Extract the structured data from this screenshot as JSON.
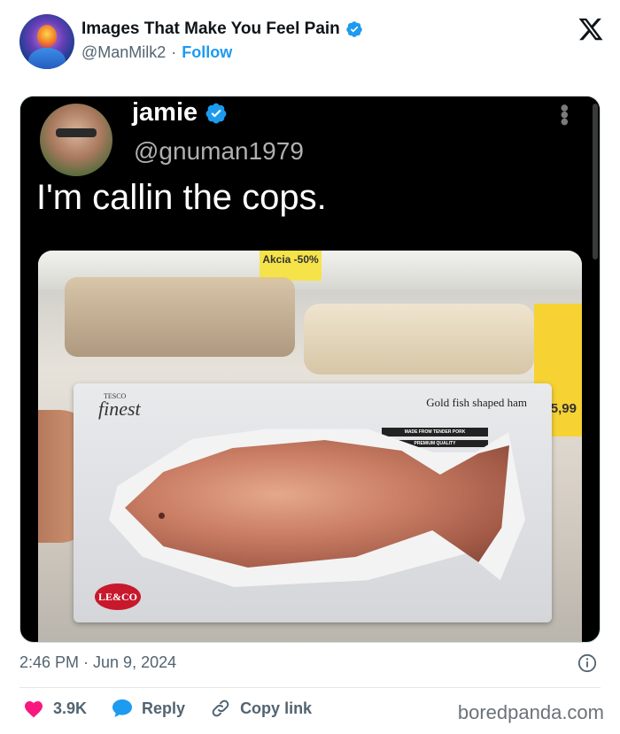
{
  "header": {
    "account_name": "Images That Make You Feel Pain",
    "handle": "@ManMilk2",
    "separator": "·",
    "follow_label": "Follow"
  },
  "embedded_tweet": {
    "name": "jamie",
    "handle": "@gnuman1979",
    "text": "I'm callin the cops."
  },
  "photo_text": {
    "package_brand_small": "TESCO",
    "package_brand": "finest",
    "package_title": "Gold fish shaped ham",
    "package_strip1": "MADE FROM TENDER PORK",
    "package_strip2": "PREMIUM QUALITY",
    "package_logo": "LE&CO",
    "shelf_tag": "Akcia -50%",
    "price_right": "5,99"
  },
  "timestamp": "2:46 PM · Jun 9, 2024",
  "actions": {
    "likes": "3.9K",
    "reply_label": "Reply",
    "copy_link_label": "Copy link"
  },
  "watermark": "boredpanda.com",
  "colors": {
    "accent": "#1d9bf0",
    "like": "#f91880",
    "text_secondary": "#536471"
  },
  "icons": {
    "verified": "verified-badge-icon",
    "x_logo": "x-logo-icon",
    "info": "info-icon",
    "like": "heart-icon",
    "reply": "reply-bubble-icon",
    "link": "link-icon"
  }
}
